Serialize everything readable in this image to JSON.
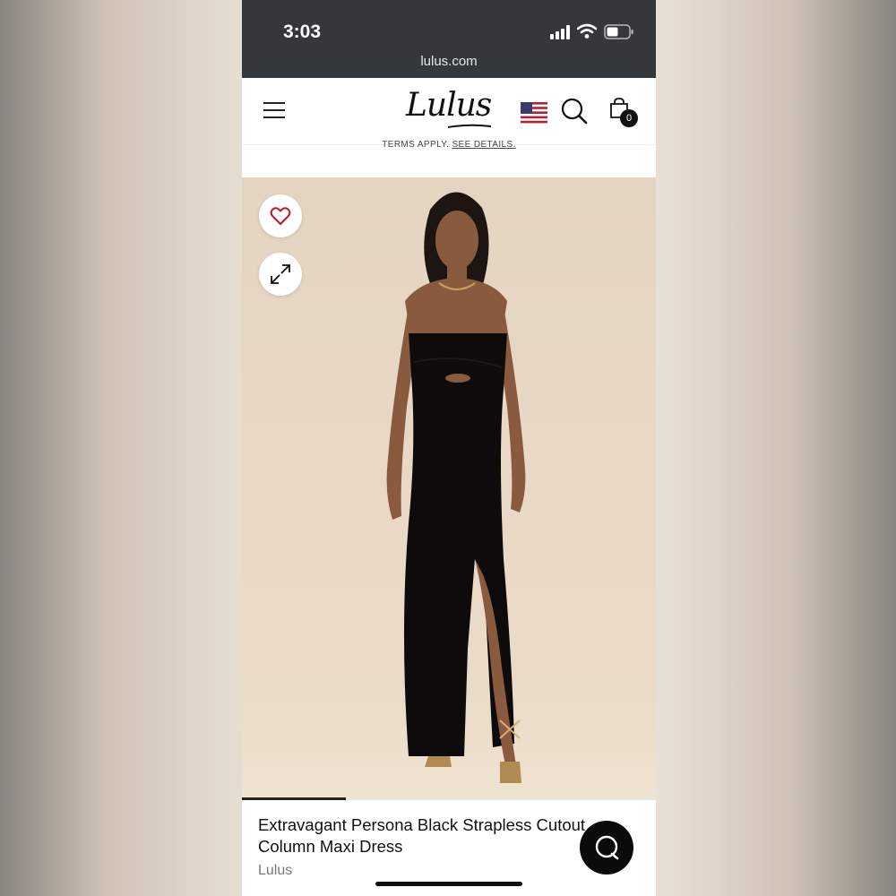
{
  "status_bar": {
    "time": "3:03",
    "url": "lulus.com"
  },
  "header": {
    "logo_text": "Lulus",
    "cart_count": "0"
  },
  "promo": {
    "text": "TERMS APPLY.",
    "link": "SEE DETAILS."
  },
  "gallery": {
    "progress": 0.25
  },
  "product": {
    "title_line1": "Extravagant Persona Black Strapless Cutout",
    "title_line2": "Column Maxi Dress",
    "brand": "Lulus"
  },
  "colors": {
    "status_bar_bg": "#35383b",
    "hero_bg": "#e4d4c2",
    "heart": "#c0152a",
    "text": "#111111",
    "chat_bg": "#0b0b0b"
  },
  "icons": [
    "menu-icon",
    "us-flag-icon",
    "search-icon",
    "shopping-bag-icon",
    "heart-icon",
    "expand-icon",
    "chat-icon",
    "signal-icon",
    "wifi-icon",
    "battery-icon"
  ]
}
